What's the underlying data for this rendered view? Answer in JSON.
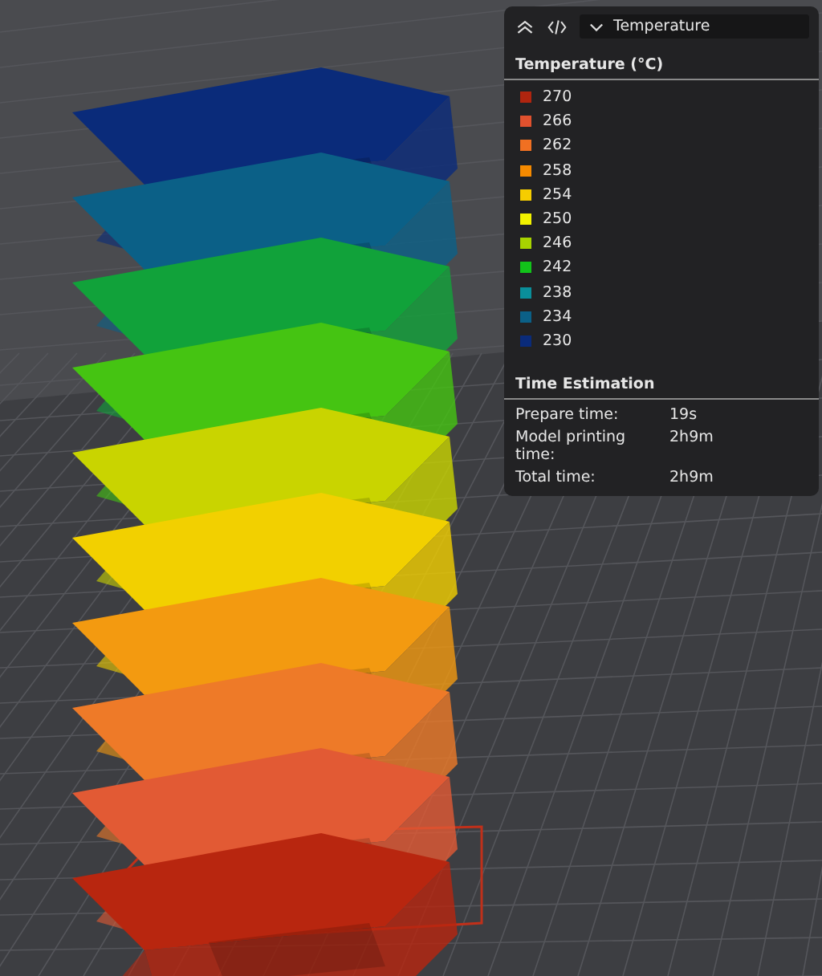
{
  "legend_panel": {
    "view_dropdown": {
      "value": "Temperature"
    },
    "title": "Temperature (°C)",
    "items": [
      {
        "label": "270",
        "color": "#b0250f"
      },
      {
        "label": "266",
        "color": "#e0512e"
      },
      {
        "label": "262",
        "color": "#f07022"
      },
      {
        "label": "258",
        "color": "#f58a00"
      },
      {
        "label": "254",
        "color": "#f6cd00"
      },
      {
        "label": "250",
        "color": "#f2f200"
      },
      {
        "label": "246",
        "color": "#a8d400"
      },
      {
        "label": "242",
        "color": "#12c41a"
      },
      {
        "label": "238",
        "color": "#0a8f9a"
      },
      {
        "label": "234",
        "color": "#0b6087"
      },
      {
        "label": "230",
        "color": "#0a2b7a"
      }
    ],
    "time_estimation": {
      "title": "Time Estimation",
      "rows": [
        {
          "label": "Prepare time:",
          "value": "19s"
        },
        {
          "label": "Model printing time:",
          "value": "2h9m"
        },
        {
          "label": "Total time:",
          "value": "2h9m"
        }
      ]
    }
  }
}
